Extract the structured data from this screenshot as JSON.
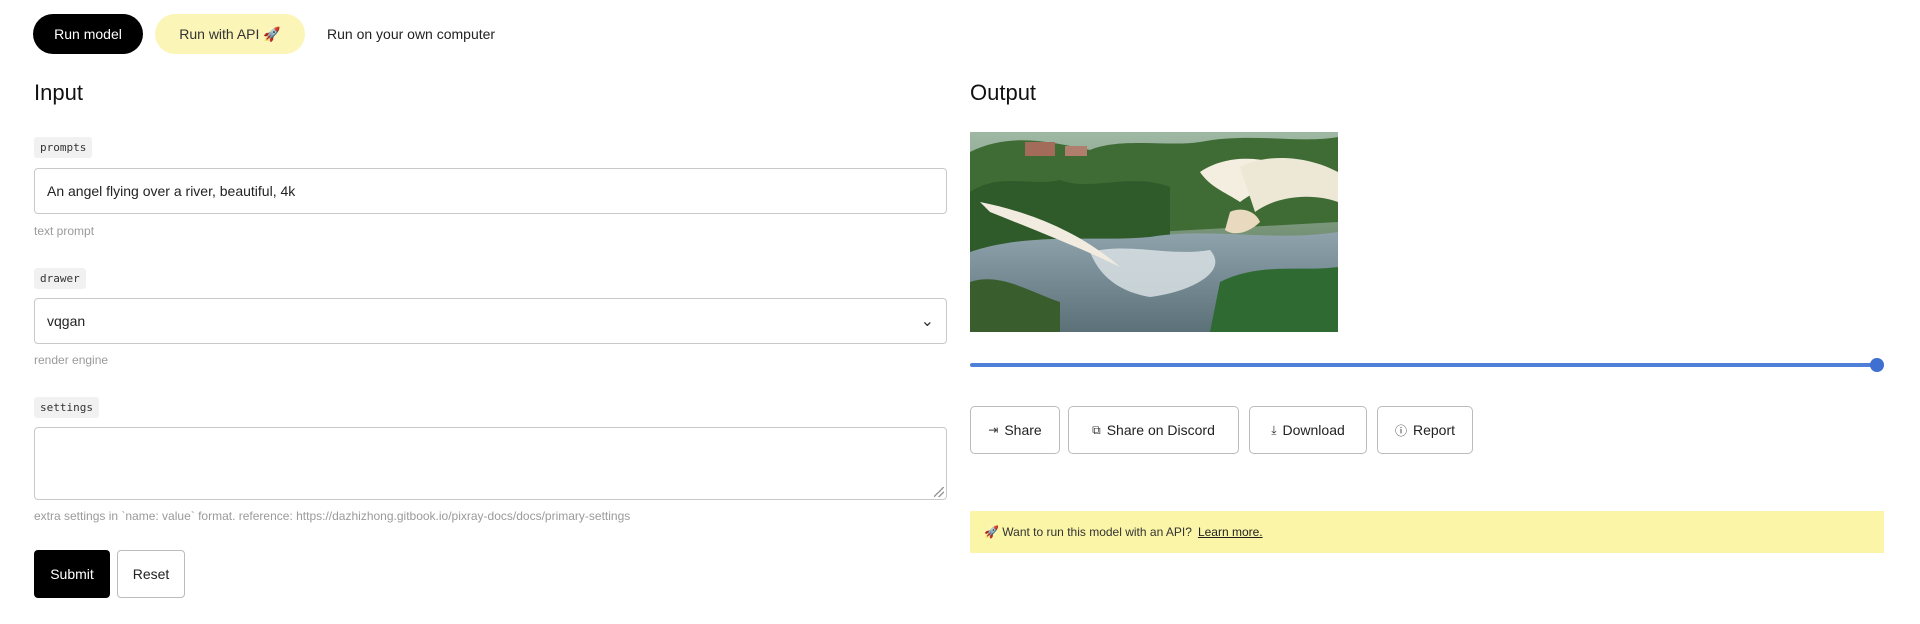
{
  "top_tabs": {
    "run_model": "Run model",
    "run_with_api": "Run with API 🚀",
    "run_own_computer": "Run on your own computer"
  },
  "input": {
    "title": "Input",
    "prompts": {
      "label": "prompts",
      "value": "An angel flying over a river, beautiful, 4k",
      "hint": "text prompt"
    },
    "drawer": {
      "label": "drawer",
      "value": "vqgan",
      "hint": "render engine"
    },
    "settings": {
      "label": "settings",
      "value": "",
      "hint": "extra settings in `name: value` format. reference: https://dazhizhong.gitbook.io/pixray-docs/docs/primary-settings"
    },
    "submit_label": "Submit",
    "reset_label": "Reset"
  },
  "output": {
    "title": "Output",
    "progress": 1.0,
    "buttons": {
      "share": "Share",
      "share_discord": "Share on Discord",
      "download": "Download",
      "report": "Report"
    },
    "banner": {
      "text": "🚀 Want to run this model with an API?",
      "link": "Learn more."
    }
  },
  "colors": {
    "accent_blue": "#4e7fd9",
    "api_yellow": "#fbf5a8",
    "primary_black": "#000000"
  },
  "icons": [
    "share-icon",
    "copy-icon",
    "download-icon",
    "report-icon",
    "chevron-down-icon"
  ]
}
